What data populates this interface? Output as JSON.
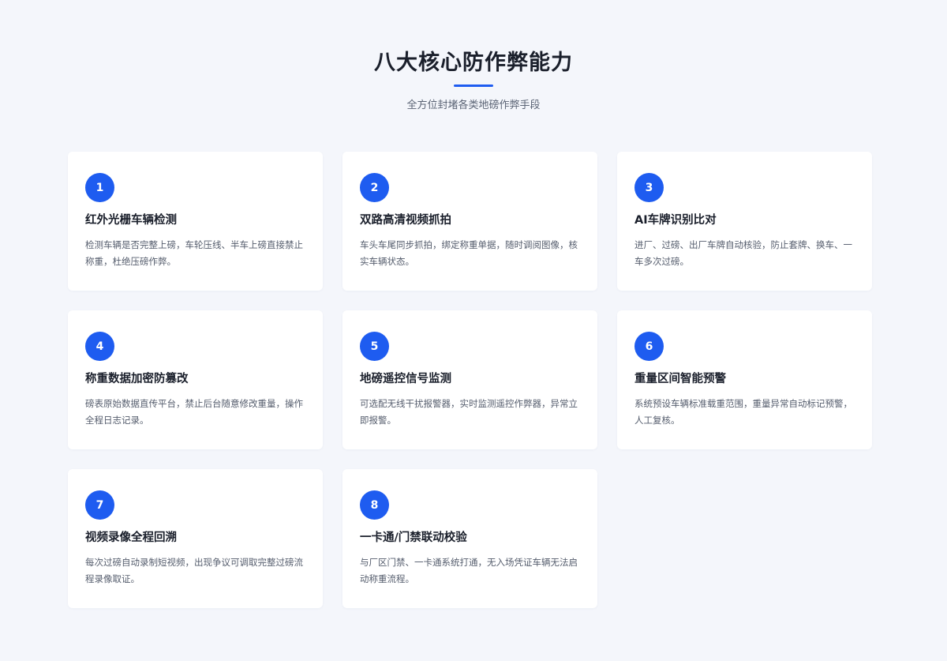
{
  "header": {
    "title": "八大核心防作弊能力",
    "subtitle": "全方位封堵各类地磅作弊手段",
    "accent_color": "#1e5cf0"
  },
  "features": [
    {
      "number": "1",
      "title": "红外光栅车辆检测",
      "description": "检测车辆是否完整上磅，车轮压线、半车上磅直接禁止称重，杜绝压磅作弊。"
    },
    {
      "number": "2",
      "title": "双路高清视频抓拍",
      "description": "车头车尾同步抓拍，绑定称重单据，随时调阅图像，核实车辆状态。"
    },
    {
      "number": "3",
      "title": "AI车牌识别比对",
      "description": "进厂、过磅、出厂车牌自动核验，防止套牌、换车、一车多次过磅。"
    },
    {
      "number": "4",
      "title": "称重数据加密防篡改",
      "description": "磅表原始数据直传平台，禁止后台随意修改重量，操作全程日志记录。"
    },
    {
      "number": "5",
      "title": "地磅遥控信号监测",
      "description": "可选配无线干扰报警器，实时监测遥控作弊器，异常立即报警。"
    },
    {
      "number": "6",
      "title": "重量区间智能预警",
      "description": "系统预设车辆标准载重范围，重量异常自动标记预警，人工复核。"
    },
    {
      "number": "7",
      "title": "视频录像全程回溯",
      "description": "每次过磅自动录制短视频，出现争议可调取完整过磅流程录像取证。"
    },
    {
      "number": "8",
      "title": "一卡通/门禁联动校验",
      "description": "与厂区门禁、一卡通系统打通，无入场凭证车辆无法启动称重流程。"
    }
  ]
}
